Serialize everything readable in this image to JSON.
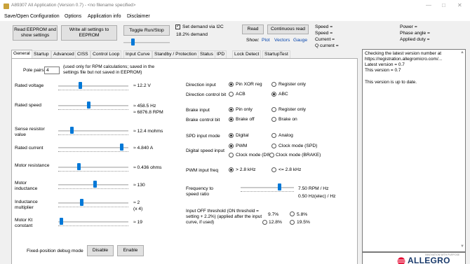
{
  "window": {
    "title": "A89307 All Application (Version 0.7) - <no filename specified>",
    "minimize": "—",
    "maximize": "□",
    "close": "✕"
  },
  "menu": [
    "Save/Open Configuration",
    "Options",
    "Application info",
    "Disclaimer"
  ],
  "toolbar": {
    "read_eeprom": "Read EEPROM and show settings",
    "write_all": "Write all settings to EEPROM",
    "toggle_run": "Toggle Run/Stop",
    "set_demand_label": "Set demand via I2C",
    "set_demand_checked": true,
    "demand_text": "18.2% demand",
    "demand_fraction": 0.182,
    "read": "Read",
    "continuous_read": "Continuous read",
    "show_label": "Show:",
    "show_links": [
      "Plot",
      "Vectors",
      "Gauge"
    ]
  },
  "readouts": {
    "speed1": "Speed =",
    "speed2": "Speed =",
    "current": "Current =",
    "q_current": "Q current =",
    "power": "Power =",
    "phase_angle": "Phase angle =",
    "applied_duty": "Applied duty ="
  },
  "tabs": [
    "General",
    "Startup",
    "Advanced",
    "CISS",
    "Control Loop",
    "Input Curve",
    "Standby / Protection",
    "Status",
    "IPD",
    "Lock Detect",
    "StartupTest"
  ],
  "general": {
    "pole_pairs_label": "Pole pairs",
    "pole_pairs_value": "4",
    "pole_pairs_note": "(used only for RPM calculations; saved in the settings file but not saved in EEPROM)",
    "sliders": [
      {
        "label": "Rated voltage",
        "value": "≈ 12.2 V",
        "fraction": 0.3
      },
      {
        "label": "Rated speed",
        "value": "≈ 458.5 Hz",
        "value2": "≈ 6876.8 RPM",
        "fraction": 0.43
      },
      {
        "label": "Sense resistor value",
        "value": "≈ 12.4 mohms",
        "fraction": 0.18
      },
      {
        "label": "Rated current",
        "value": "≈ 4.840 A",
        "fraction": 0.93
      },
      {
        "label": "Motor resistance",
        "value": "≈ 0.436 ohms",
        "fraction": 0.28
      },
      {
        "label": "Motor inductance",
        "value": "≈ 130",
        "fraction": 0.53
      },
      {
        "label": "Inductance multiplier",
        "value": "≈ 2",
        "value2": "(x 4)",
        "fraction": 0.33
      },
      {
        "label": "Motor Kt constant",
        "value": "≈ 19",
        "fraction": 0.02
      }
    ],
    "debug_label": "Fixed-position debug mode",
    "disable": "Disable",
    "enable": "Enable"
  },
  "options": {
    "direction_input": {
      "label": "Direction input",
      "opts": [
        "Pin XOR reg",
        "Register only"
      ],
      "selected": 0
    },
    "direction_control": {
      "label": "Direction control bit",
      "opts": [
        "ACB",
        "ABC"
      ],
      "selected": 1
    },
    "brake_input": {
      "label": "Brake input",
      "opts": [
        "Pin only",
        "Register only"
      ],
      "selected": 0
    },
    "brake_control": {
      "label": "Brake control bit",
      "opts": [
        "Brake off",
        "Brake on"
      ],
      "selected": 0
    },
    "spd_input": {
      "label": "SPD input mode",
      "opts": [
        "Digital",
        "Analog"
      ],
      "selected": 0
    },
    "digital_speed": {
      "label": "Digital speed input",
      "opts": [
        "PWM",
        "Clock mode (SPD)",
        "Clock mode (DIR)",
        "Clock mode (BRAKE)"
      ],
      "selected": 0
    },
    "pwm_freq": {
      "label": "PWM input freq",
      "opts": [
        "> 2.8 kHz",
        "<= 2.8 kHz"
      ],
      "selected": 0
    },
    "freq_ratio": {
      "label": "Frequency to speed ratio",
      "value": "7.50 RPM / Hz",
      "value2": "0.50 Hz(elec) / Hz",
      "fraction": 0.74
    },
    "input_off": {
      "label": "Input OFF threshold (ON threshold = setting + 2.2%) (applied after the input curve, if used)",
      "opts": [
        "9.7%",
        "5.8%",
        "12.8%",
        "19.5%"
      ],
      "selected": 0
    }
  },
  "info": {
    "lines": [
      "Checking the latest version number at https://registration.allegromicro.com/...",
      "Latest version = 0.7",
      "This version = 0.7",
      "",
      "This version is up to date."
    ]
  },
  "logo": {
    "tagline": "INNOVATION WITH PURPOSE",
    "name": "ALLEGRO",
    "sub": "microsystems",
    "color": "#e4002b"
  }
}
